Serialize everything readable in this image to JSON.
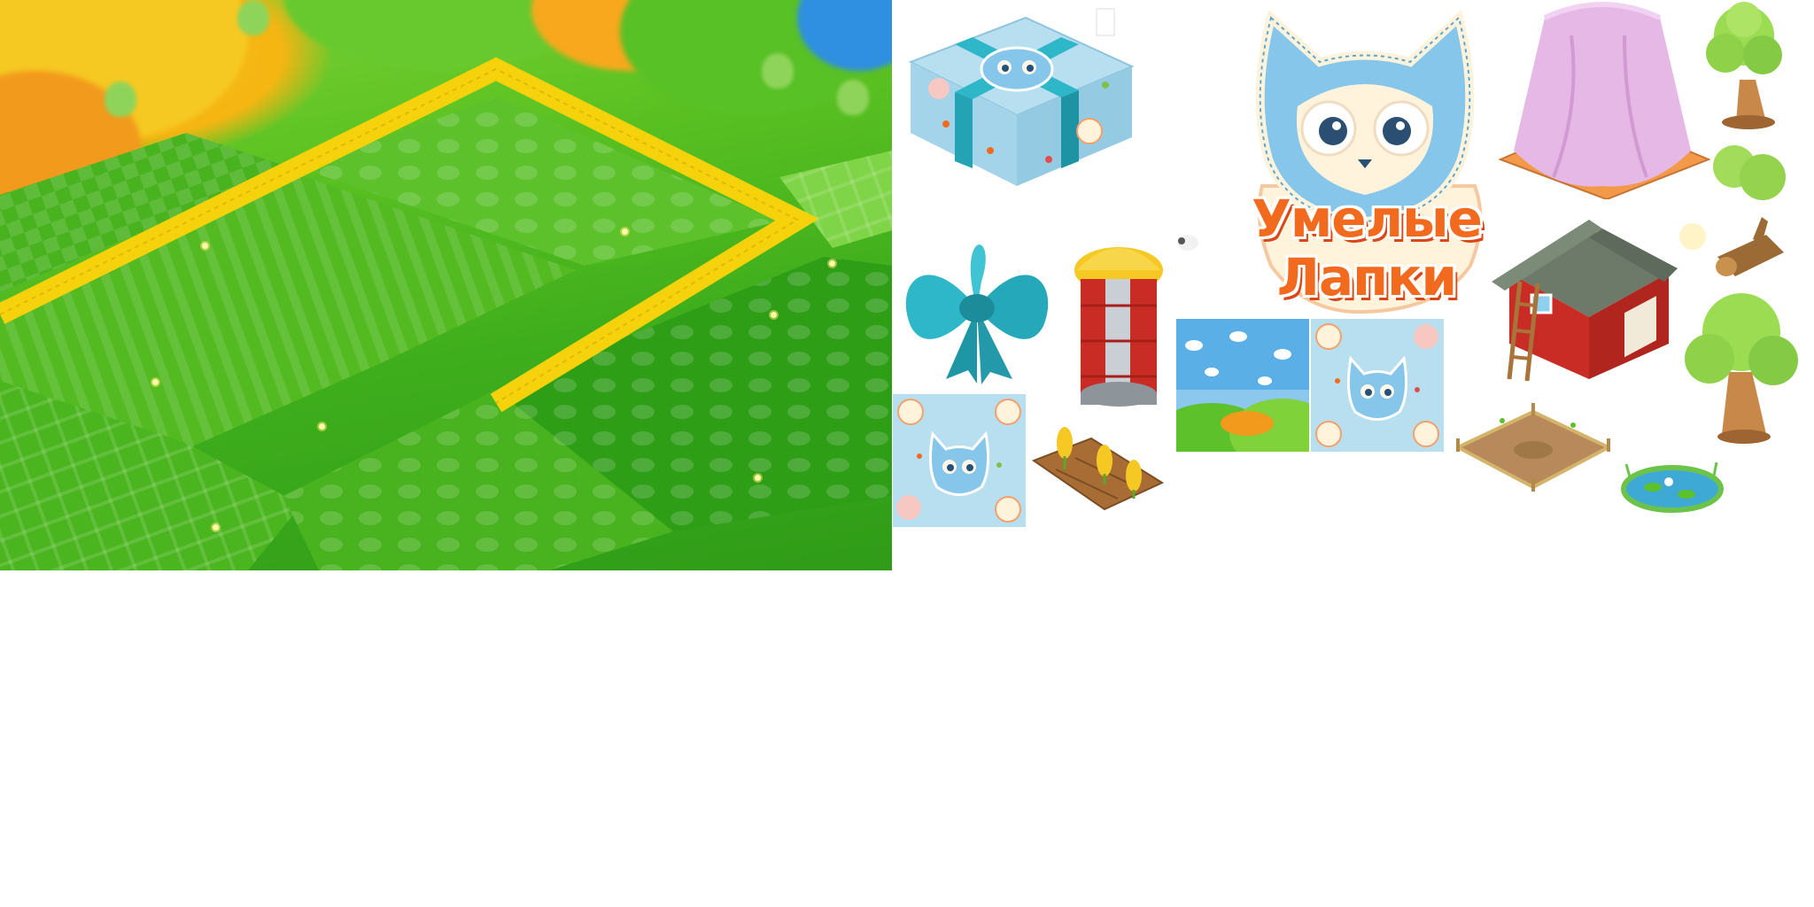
{
  "logo": {
    "line1": "Умелые",
    "line2": "Лапки"
  },
  "colors": {
    "field_green": "#3fae1c",
    "road_yellow": "#f5d20c",
    "sky_blue": "#8cc8ee",
    "ribbon_teal": "#2db7c9",
    "logo_orange": "#f26a1e",
    "cat_blue": "#86c6ea",
    "barn_red": "#c82c24",
    "tree_green": "#9bdc52",
    "cloth_pink": "#e6b8e6"
  },
  "atlas_items": [
    "farm-field-texture",
    "gift-box-icon",
    "ribbon-bow-icon",
    "silo-icon",
    "sheep-icon",
    "logo-cat-icon",
    "curtain-cover-icon",
    "barn-icon",
    "tree-icon",
    "bush-icon",
    "log-icon",
    "sun-icon",
    "sky-landscape-tile",
    "cat-pattern-tile",
    "wheat-bed-icon",
    "fenced-pen-icon",
    "pond-icon"
  ]
}
